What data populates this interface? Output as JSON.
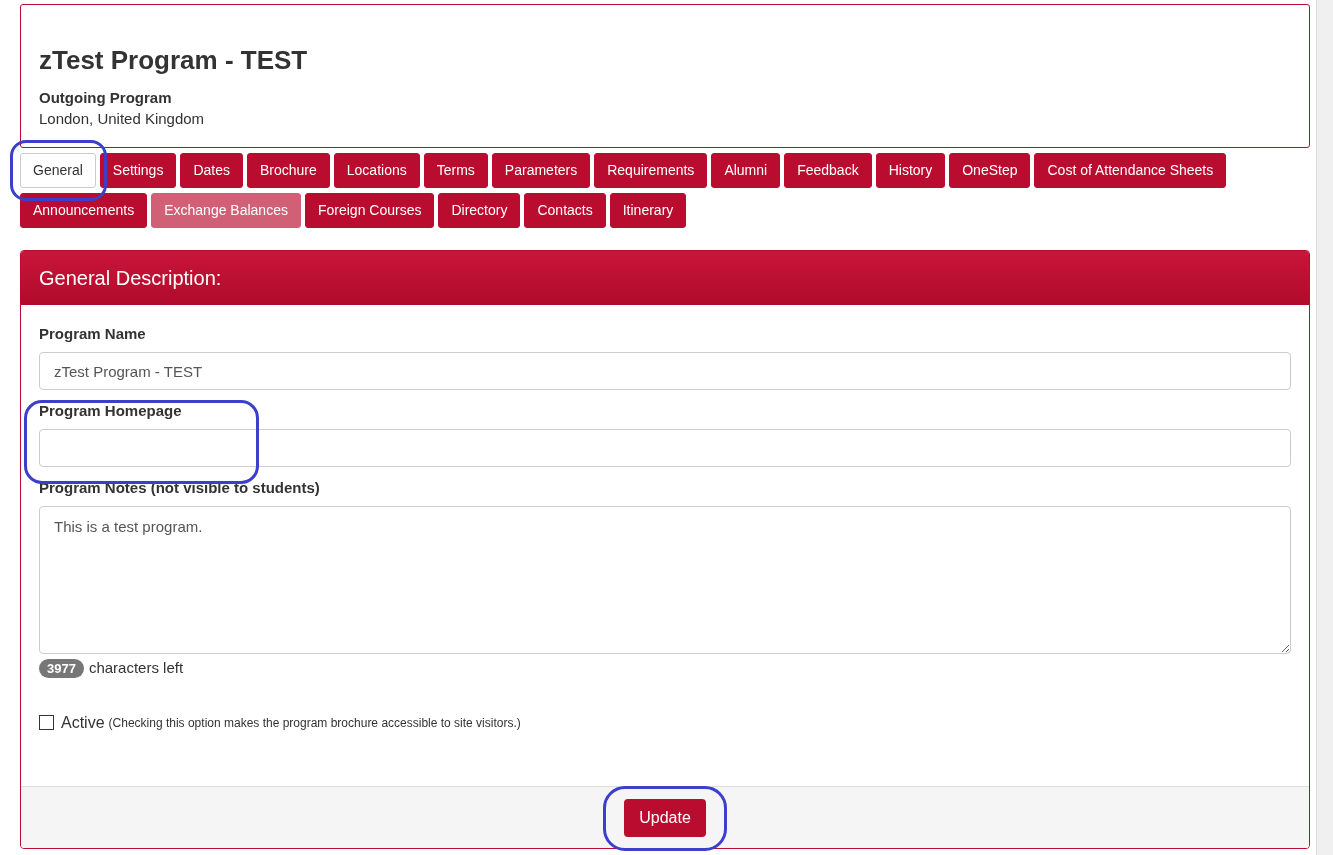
{
  "header": {
    "title": "zTest Program - TEST",
    "type": "Outgoing Program",
    "location": "London, United Kingdom"
  },
  "tabs": [
    {
      "label": "General",
      "selected": true,
      "disabled": false
    },
    {
      "label": "Settings",
      "selected": false,
      "disabled": false
    },
    {
      "label": "Dates",
      "selected": false,
      "disabled": false
    },
    {
      "label": "Brochure",
      "selected": false,
      "disabled": false
    },
    {
      "label": "Locations",
      "selected": false,
      "disabled": false
    },
    {
      "label": "Terms",
      "selected": false,
      "disabled": false
    },
    {
      "label": "Parameters",
      "selected": false,
      "disabled": false
    },
    {
      "label": "Requirements",
      "selected": false,
      "disabled": false
    },
    {
      "label": "Alumni",
      "selected": false,
      "disabled": false
    },
    {
      "label": "Feedback",
      "selected": false,
      "disabled": false
    },
    {
      "label": "History",
      "selected": false,
      "disabled": false
    },
    {
      "label": "OneStep",
      "selected": false,
      "disabled": false
    },
    {
      "label": "Cost of Attendance Sheets",
      "selected": false,
      "disabled": false
    },
    {
      "label": "Announcements",
      "selected": false,
      "disabled": false
    },
    {
      "label": "Exchange Balances",
      "selected": false,
      "disabled": true
    },
    {
      "label": "Foreign Courses",
      "selected": false,
      "disabled": false
    },
    {
      "label": "Directory",
      "selected": false,
      "disabled": false
    },
    {
      "label": "Contacts",
      "selected": false,
      "disabled": false
    },
    {
      "label": "Itinerary",
      "selected": false,
      "disabled": false
    }
  ],
  "panel": {
    "title": "General Description:",
    "fields": [
      {
        "label": "Program Name",
        "value": "zTest Program - TEST"
      },
      {
        "label": "Program Homepage"
      }
    ],
    "notes": {
      "label": "Program Notes (not visible to students)",
      "value": "This is a test program.",
      "count": "3977",
      "count_text": "characters left"
    },
    "active": {
      "label": "Active",
      "note": "(Checking this option makes the program brochure accessible to site visitors.)",
      "checked": false
    },
    "button": "Update"
  }
}
